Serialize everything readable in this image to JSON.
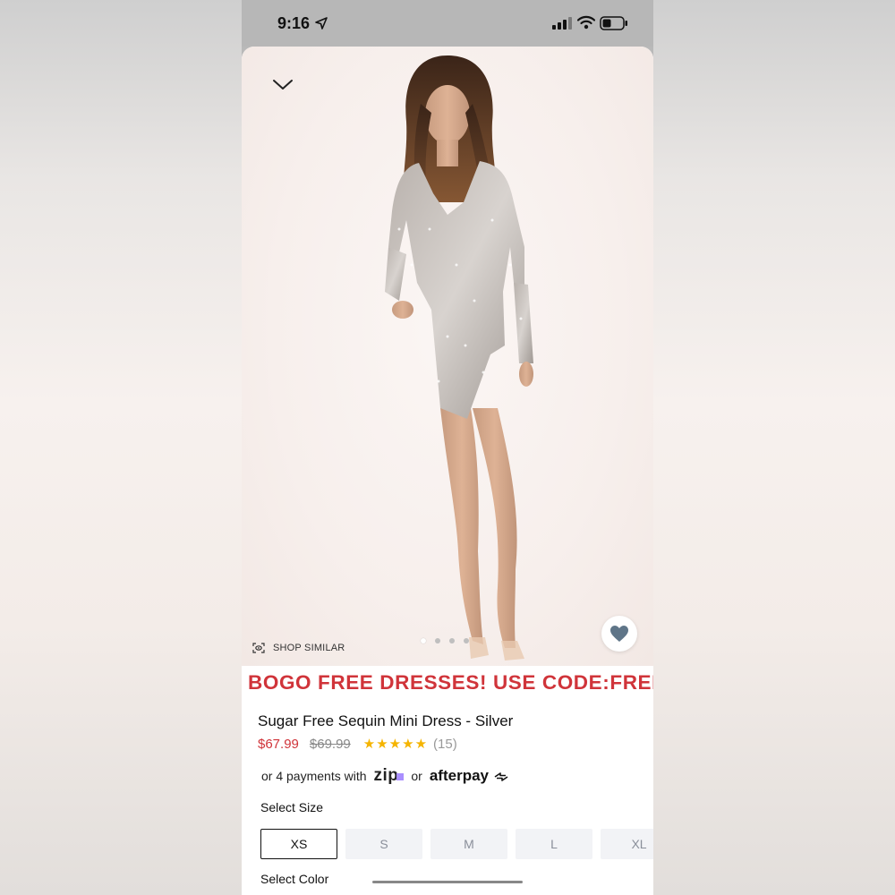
{
  "status_bar": {
    "time": "9:16"
  },
  "gallery": {
    "shop_similar_label": "SHOP SIMILAR",
    "dots_count": 4,
    "active_dot": 0
  },
  "promo": {
    "text": "BOGO FREE DRESSES! USE CODE:FREE",
    "color": "#d0343a"
  },
  "product": {
    "title": "Sugar Free Sequin Mini Dress - Silver",
    "sale_price": "$67.99",
    "original_price": "$69.99",
    "stars": "★★★★★",
    "review_count": "(15)"
  },
  "payments": {
    "prefix": "or 4 payments with",
    "zip_label": "zip",
    "or_label": "or",
    "afterpay_label": "afterpay"
  },
  "size_selector": {
    "label": "Select Size",
    "options": [
      "XS",
      "S",
      "M",
      "L",
      "XL"
    ],
    "selected": "XS"
  },
  "color_selector": {
    "label": "Select Color"
  },
  "icons": {
    "collapse": "chevron-down-icon",
    "location": "location-arrow-icon",
    "signal": "signal-icon",
    "wifi": "wifi-icon",
    "battery": "battery-icon",
    "shop_similar": "camera-scan-icon",
    "favorite": "heart-icon"
  }
}
